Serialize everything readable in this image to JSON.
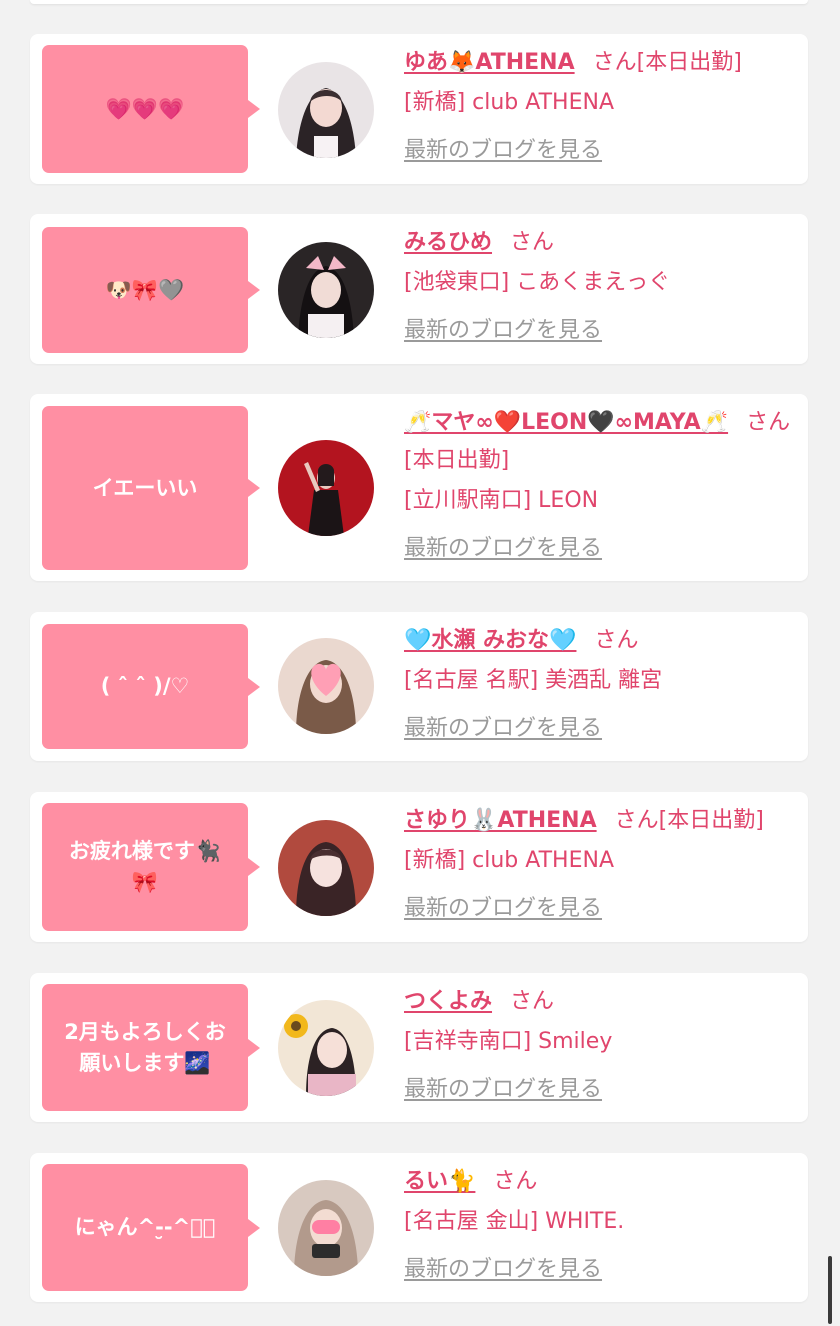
{
  "blog_link_label": "最新のブログを見る",
  "colors": {
    "accent": "#ff8fa3",
    "name": "#e0456c",
    "link": "#9a9a9a"
  },
  "entries": [
    {
      "comment": "💗💗💗",
      "name": "ゆあ🦊ATHENA",
      "suffix": "さん[本日出勤]",
      "shop": "[新橋] club ATHENA",
      "avatar_icon": "avatar-photo"
    },
    {
      "comment": "🐶🎀🩶",
      "name": "みるひめ",
      "suffix": "さん",
      "shop": "[池袋東口] こあくまえっぐ",
      "avatar_icon": "avatar-photo"
    },
    {
      "comment": "イエーいい",
      "name": "🥂マヤ∞❤️LEON🖤∞MAYA🥂",
      "suffix": "さん[本日出勤]",
      "shop": "[立川駅南口] LEON",
      "avatar_icon": "avatar-photo"
    },
    {
      "comment": "( ˆ ˆ )/♡",
      "name": "🩵水瀬 みおな🩵",
      "suffix": "さん",
      "shop": "[名古屋 名駅] 美酒乱 離宮",
      "avatar_icon": "avatar-photo"
    },
    {
      "comment": "お疲れ様です🐈‍⬛🎀",
      "name": "さゆり🐰ATHENA",
      "suffix": "さん[本日出勤]",
      "shop": "[新橋] club ATHENA",
      "avatar_icon": "avatar-photo"
    },
    {
      "comment": "2月もよろしくお願いします🌌",
      "name": "つくよみ",
      "suffix": "さん",
      "shop": "[吉祥寺南口] Smiley",
      "avatar_icon": "avatar-photo"
    },
    {
      "comment": "にゃん^-̮-^ฅ゙",
      "name": "るい🐈",
      "suffix": "さん",
      "shop": "[名古屋 金山] WHITE.",
      "avatar_icon": "avatar-photo"
    }
  ]
}
